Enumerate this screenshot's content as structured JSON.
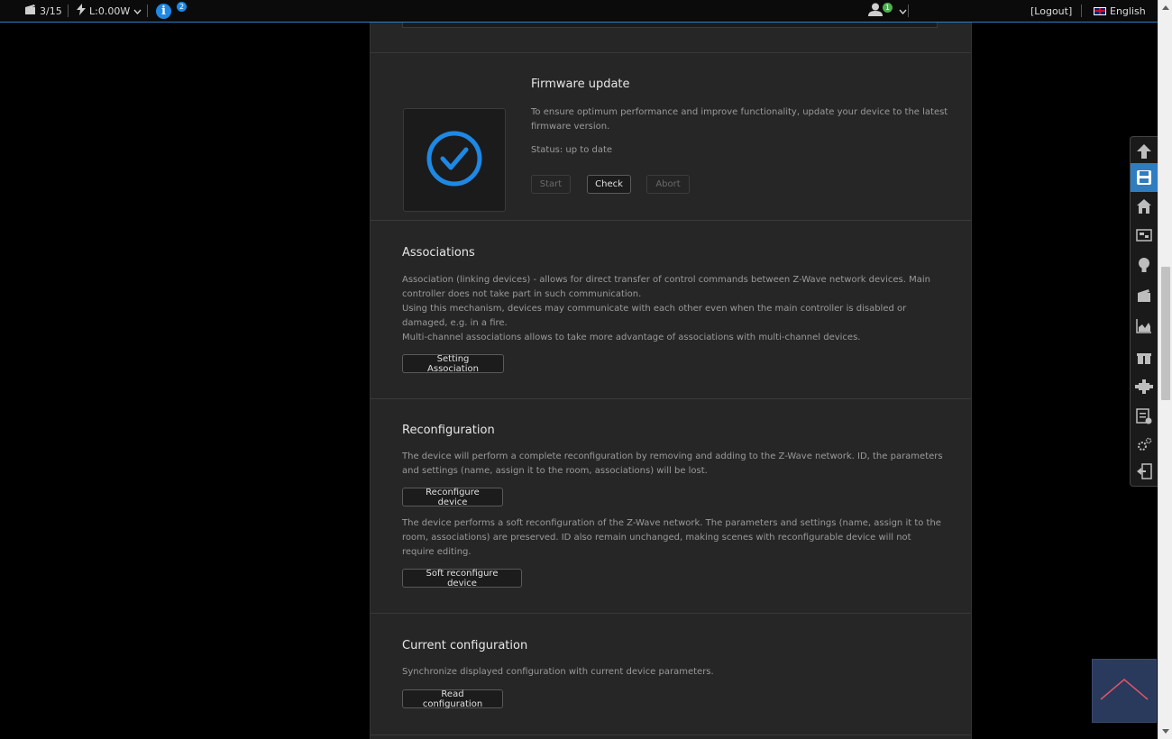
{
  "topbar": {
    "devices_count": "3/15",
    "power": "L:0.00W",
    "info_count": "2",
    "user_count": "1",
    "logout": "[Logout]",
    "language": "English"
  },
  "firmware": {
    "title": "Firmware update",
    "description": "To ensure optimum performance and improve functionality, update your device to the latest firmware version.",
    "status": "Status: up to date",
    "start": "Start",
    "check": "Check",
    "abort": "Abort",
    "accent": "#1e88e5"
  },
  "associations": {
    "title": "Associations",
    "line1": "Association (linking devices) - allows for direct transfer of control commands between Z-Wave network devices. Main controller does not take part in such communication.",
    "line2": "Using this mechanism, devices may communicate with each other even when the main controller is disabled or damaged, e.g. in a fire.",
    "line3": "Multi-channel associations allows to take more advantage of associations with multi-channel devices.",
    "button": "Setting Association"
  },
  "reconfiguration": {
    "title": "Reconfiguration",
    "text1": "The device will perform a complete reconfiguration by removing and adding to the Z-Wave network. ID, the parameters and settings (name, assign it to the room, associations) will be lost.",
    "button1": "Reconfigure device",
    "text2": "The device performs a soft reconfiguration of the Z-Wave network. The parameters and settings (name, assign it to the room, associations) are preserved. ID also remain unchanged, making scenes with reconfigurable device will not require editing.",
    "button2": "Soft reconfigure device"
  },
  "current_config": {
    "title": "Current configuration",
    "text": "Synchronize displayed configuration with current device parameters.",
    "button": "Read configuration"
  },
  "sidebar_icons": [
    "arrow-up-icon",
    "save-icon",
    "home-icon",
    "devices-icon",
    "bulb-icon",
    "scene-icon",
    "chart-icon",
    "gift-icon",
    "plugin-icon",
    "settings-list-icon",
    "gears-icon",
    "exit-icon"
  ],
  "colors": {
    "accent": "#2f7dc1",
    "panel": "#262626",
    "background": "#000000"
  }
}
